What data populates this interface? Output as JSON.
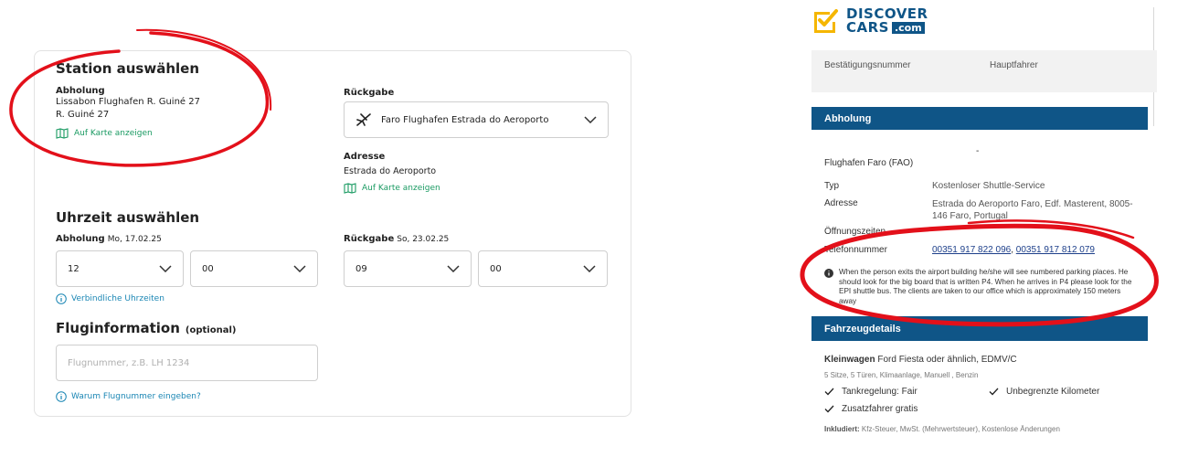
{
  "left": {
    "station_title": "Station auswählen",
    "pickup_label": "Abholung",
    "pickup_line1": "Lissabon Flughafen R. Guiné 27",
    "pickup_line2": "R. Guiné 27",
    "map_link": "Auf Karte anzeigen",
    "return_label": "Rückgabe",
    "return_select": "Faro Flughafen Estrada do Aeroporto",
    "address_label": "Adresse",
    "address_value": "Estrada do Aeroporto",
    "time_title": "Uhrzeit auswählen",
    "pickup_time_label": "Abholung",
    "pickup_date": "Mo, 17.02.25",
    "pickup_hour": "12",
    "pickup_minute": "00",
    "return_time_label": "Rückgabe",
    "return_date": "So, 23.02.25",
    "return_hour": "09",
    "return_minute": "00",
    "binding_times": "Verbindliche Uhrzeiten",
    "flight_title": "Fluginformation",
    "flight_optional": "(optional)",
    "flight_placeholder": "Flugnummer, z.B. LH 1234",
    "flight_why": "Warum Flugnummer eingeben?"
  },
  "right": {
    "logo_line1": "DISCOVER",
    "logo_line2": "CARS",
    "logo_com": ".com",
    "conf_label": "Bestätigungsnummer",
    "driver_label": "Hauptfahrer",
    "pickup_header": "Abholung",
    "dash": "-",
    "airport": "Flughafen Faro (FAO)",
    "type_label": "Typ",
    "type_value": "Kostenloser Shuttle-Service",
    "address_label": "Adresse",
    "address_value": "Estrada do Aeroporto Faro, Edf. Masterent, 8005-146 Faro, Portugal",
    "hours_label": "Öffnungszeiten",
    "phone_label": "Telefonnummer",
    "phone1": "00351 917 822 096",
    "phone_sep": ", ",
    "phone2": "00351 917 812 079",
    "note": "When the person exits the airport building he/she will see numbered parking places. He should look for the big board that is written P4. When he arrives in P4 please look for the EPI shuttle bus. The clients are taken to our office which is approximately 150 meters away",
    "vehicle_header": "Fahrzeugdetails",
    "car_class": "Kleinwagen",
    "car_model": "Ford Fiesta oder ähnlich, EDMV/C",
    "car_specs": "5 Sitze, 5 Türen, Klimaanlage, Manuell , Benzin",
    "feat1": "Tankregelung: Fair",
    "feat2": "Unbegrenzte Kilometer",
    "feat3": "Zusatzfahrer gratis",
    "included_label": "Inkludiert:",
    "included_value": "Kfz-Steuer, MwSt. (Mehrwertsteuer), Kostenlose Änderungen"
  },
  "colors": {
    "brand_yellow": "#f5b600",
    "brand_blue": "#0f5587",
    "link_green": "#1a9a62",
    "info_blue": "#1a86b4",
    "highlight_red": "#e3101a"
  }
}
